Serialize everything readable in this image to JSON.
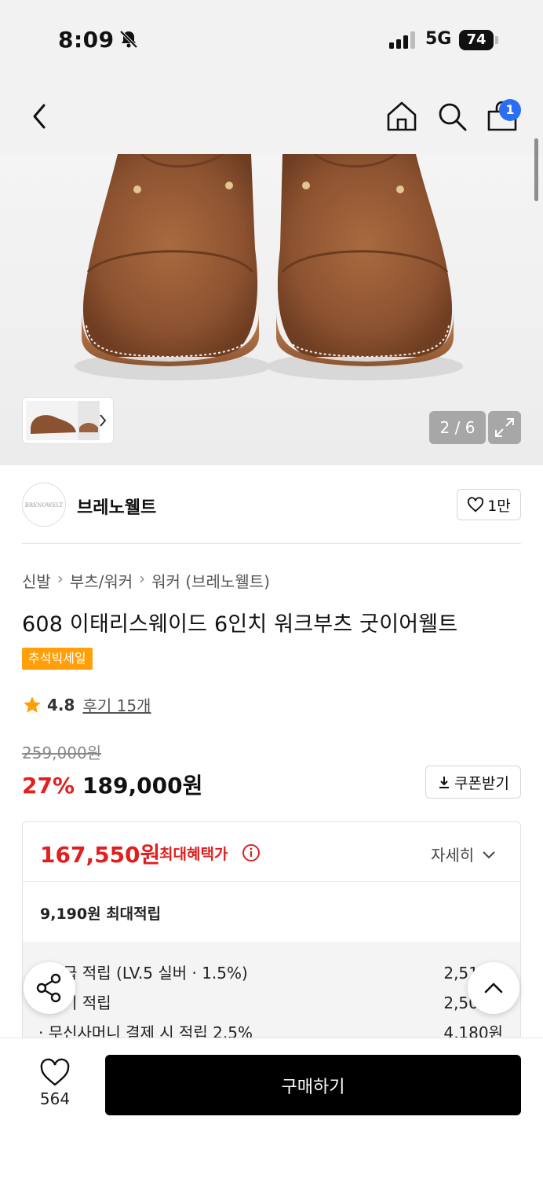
{
  "status_bar": {
    "time": "8:09",
    "network": "5G",
    "battery": "74"
  },
  "nav": {
    "cart_count": "1"
  },
  "gallery": {
    "counter": "2 / 6"
  },
  "brand": {
    "logo_text": "BRENOWELT",
    "name": "브레노웰트",
    "likes": "1만"
  },
  "breadcrumb": [
    "신발",
    "부츠/워커",
    "워커 (브레노웰트)"
  ],
  "product": {
    "title": "608 이태리스웨이드 6인치 워크부츠 굿이어웰트",
    "badge": "추석빅세일",
    "rating": "4.8",
    "review_label": "후기 15개",
    "original_price": "259,000원",
    "discount": "27%",
    "price": "189,000원",
    "coupon_label": "쿠폰받기"
  },
  "benefit": {
    "max_price": "167,550원",
    "max_label": "최대혜택가",
    "detail_label": "자세히",
    "points_label": "9,190원 최대적립",
    "lines": [
      {
        "label": "· 등급 적립 (LV.5 실버 · 1.5%)",
        "value": "2,510원"
      },
      {
        "label": "· 후기 적립",
        "value": "2,500원"
      },
      {
        "label": "· 무신사머니 결제 시 적립 2.5%",
        "value": "4,180원"
      }
    ]
  },
  "bottom": {
    "wish_count": "564",
    "buy_label": "구매하기"
  },
  "colors": {
    "accent_red": "#e02020",
    "badge_orange": "#ff9f0a",
    "cart_badge_blue": "#2b6df5"
  }
}
